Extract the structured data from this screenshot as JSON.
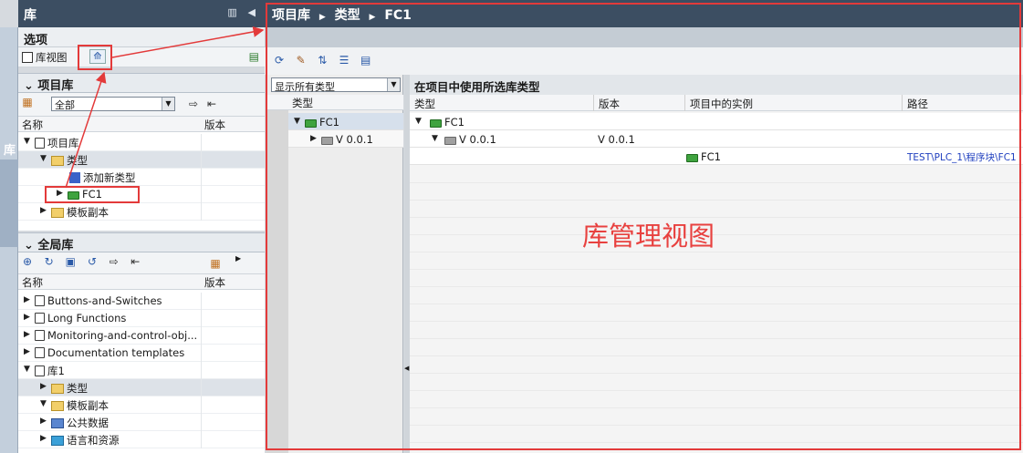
{
  "side_tab": "库",
  "left": {
    "title": "库",
    "options_label": "选项",
    "library_view_label": "库视图",
    "project_lib": {
      "title": "项目库",
      "filter_value": "全部",
      "col_name": "名称",
      "col_version": "版本",
      "items": [
        {
          "label": "项目库",
          "indent": 0,
          "expanded": true
        },
        {
          "label": "类型",
          "indent": 1,
          "expanded": true
        },
        {
          "label": "添加新类型",
          "indent": 2
        },
        {
          "label": "FC1",
          "indent": 2,
          "expanded": false
        },
        {
          "label": "模板副本",
          "indent": 1,
          "expanded": false
        }
      ]
    },
    "global_lib": {
      "title": "全局库",
      "col_name": "名称",
      "col_version": "版本",
      "items": [
        {
          "label": "Buttons-and-Switches"
        },
        {
          "label": "Long Functions"
        },
        {
          "label": "Monitoring-and-control-obj..."
        },
        {
          "label": "Documentation templates"
        },
        {
          "label": "库1"
        },
        {
          "label": "类型"
        },
        {
          "label": "模板副本"
        },
        {
          "label": "公共数据"
        },
        {
          "label": "语言和资源"
        }
      ]
    }
  },
  "right": {
    "breadcrumb": [
      "项目库",
      "类型",
      "FC1"
    ],
    "filter_value": "显示所有类型",
    "left_col_header": "类型",
    "left_tree": [
      {
        "label": "FC1"
      },
      {
        "label": "V 0.0.1"
      }
    ],
    "table_title": "在项目中使用所选库类型",
    "columns": [
      "类型",
      "版本",
      "项目中的实例",
      "路径"
    ],
    "rows": [
      {
        "type": "FC1",
        "version": "",
        "instance": "",
        "path": ""
      },
      {
        "type": "V 0.0.1",
        "version": "V 0.0.1",
        "instance": "",
        "path": ""
      },
      {
        "type": "",
        "version": "",
        "instance": "FC1",
        "path": "TEST\\PLC_1\\程序块\\FC1"
      }
    ]
  },
  "annotation": "库管理视图",
  "colors": {
    "header": "#3c4e62",
    "annotation": "#e8413f",
    "link": "#1f3fbf"
  }
}
